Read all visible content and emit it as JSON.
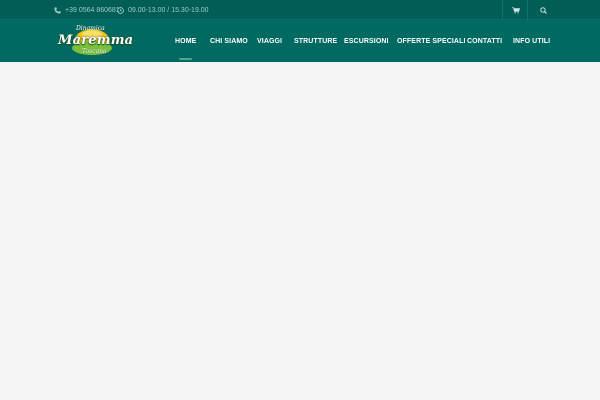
{
  "topbar": {
    "phone": "+39 0564 860681",
    "hours": "09.00-13.00 / 15.30-19.00",
    "phone_icon": "phone-icon",
    "hours_icon": "clock-icon",
    "cart_icon": "cart-icon",
    "search_icon": "search-icon"
  },
  "logo": {
    "top_text": "Dinamica",
    "main_text": "Maremma",
    "sub_text": "Toscana"
  },
  "nav": {
    "items": [
      {
        "label": "HOME",
        "active": true
      },
      {
        "label": "CHI SIAMO"
      },
      {
        "label": "VIAGGI"
      },
      {
        "label": "STRUTTURE"
      },
      {
        "label": "ESCURSIONI"
      },
      {
        "label": "OFFERTE SPECIALI"
      },
      {
        "label": "CONTATTI"
      },
      {
        "label": "INFO UTILI"
      }
    ]
  },
  "colors": {
    "topbar_bg": "#005e57",
    "navbar_bg": "#006a62",
    "page_bg": "#f5f5f5",
    "active_underline": "#4fa59c",
    "logo_yellow": "#f3c21b",
    "logo_green": "#7bbf3a"
  }
}
